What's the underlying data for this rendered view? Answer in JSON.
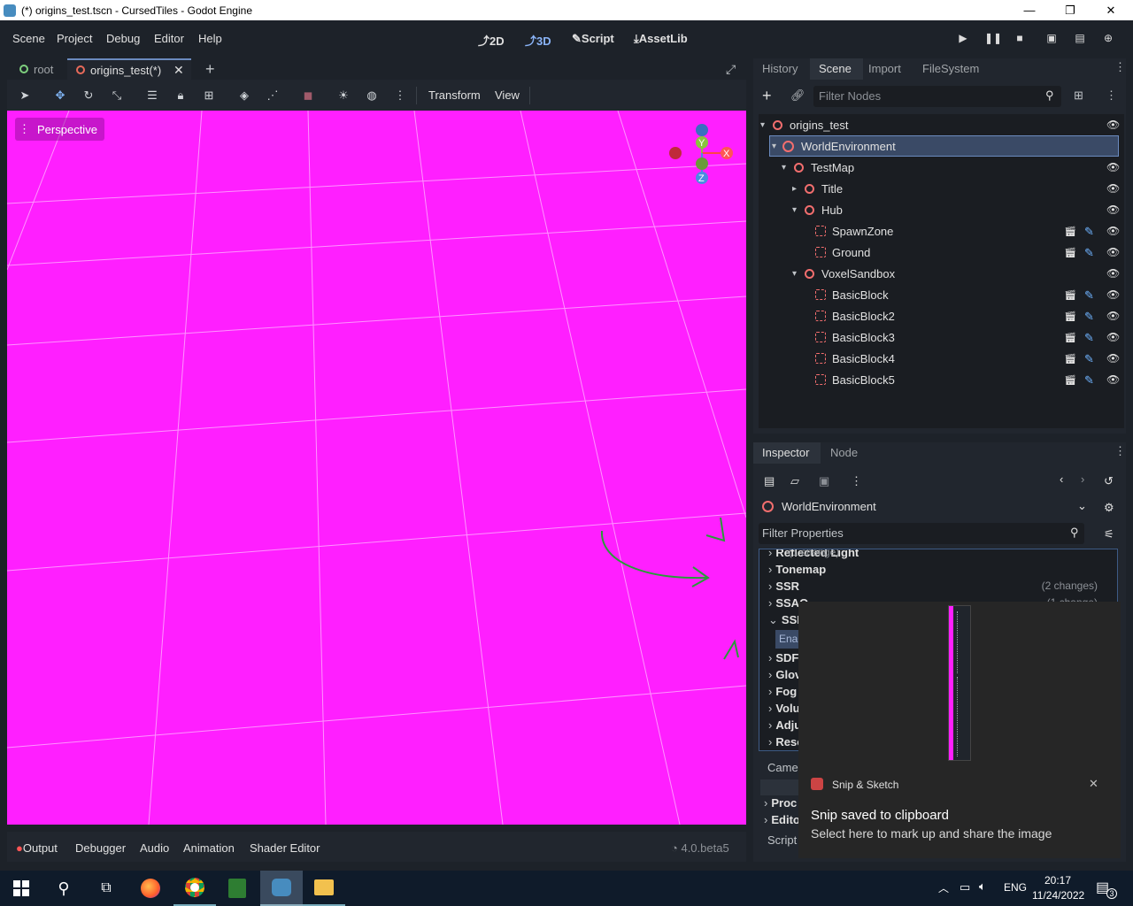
{
  "window": {
    "title": "(*) origins_test.tscn - CursedTiles - Godot Engine",
    "min": "—",
    "max": "❐",
    "close": "✕"
  },
  "menu": [
    "Scene",
    "Project",
    "Debug",
    "Editor",
    "Help"
  ],
  "workspaces": {
    "w2d": "2D",
    "w3d": "3D",
    "script": "Script",
    "assetlib": "AssetLib"
  },
  "tabs": {
    "root": "root",
    "scene": "origins_test(*)"
  },
  "toolbar": {
    "transform": "Transform",
    "view": "View"
  },
  "viewport": {
    "perspective": "Perspective",
    "bg_color": "#ff1fff",
    "gizmo": {
      "x": "X",
      "y": "Y",
      "z": "Z"
    }
  },
  "bottom": {
    "output": "Output",
    "debugger": "Debugger",
    "audio": "Audio",
    "animation": "Animation",
    "shader": "Shader Editor",
    "version": "4.0.beta5"
  },
  "dock_top": {
    "tabs": [
      "History",
      "Scene",
      "Import",
      "FileSystem"
    ],
    "filter_placeholder": "Filter Nodes",
    "nodes": [
      {
        "label": "origins_test"
      },
      {
        "label": "WorldEnvironment"
      },
      {
        "label": "TestMap"
      },
      {
        "label": "Title"
      },
      {
        "label": "Hub"
      },
      {
        "label": "SpawnZone"
      },
      {
        "label": "Ground"
      },
      {
        "label": "VoxelSandbox"
      },
      {
        "label": "BasicBlock"
      },
      {
        "label": "BasicBlock2"
      },
      {
        "label": "BasicBlock3"
      },
      {
        "label": "BasicBlock4"
      },
      {
        "label": "BasicBlock5"
      }
    ]
  },
  "inspector": {
    "tabs": [
      "Inspector",
      "Node"
    ],
    "object": "WorldEnvironment",
    "filter_placeholder": "Filter Properties",
    "sections": [
      {
        "label": "Reflected Light",
        "changes": "(1 change)"
      },
      {
        "label": "Tonemap",
        "changes": ""
      },
      {
        "label": "SSR",
        "changes": "(2 changes)"
      },
      {
        "label": "SSAO",
        "changes": "(1 change)"
      },
      {
        "label": "SSIL",
        "changes": ""
      },
      {
        "label": "Ena",
        "changes": ""
      },
      {
        "label": "SDF",
        "changes": ""
      },
      {
        "label": "Glov",
        "changes": ""
      },
      {
        "label": "Fog",
        "changes": ""
      },
      {
        "label": "Volu",
        "changes": ""
      },
      {
        "label": "Adju",
        "changes": ""
      },
      {
        "label": "Reso",
        "changes": ""
      }
    ],
    "camera": "Came",
    "proc": "Proc",
    "edito": "Edito",
    "script": "Script"
  },
  "toast": {
    "app": "Snip & Sketch",
    "title": "Snip saved to clipboard",
    "body": "Select here to mark up and share the image",
    "close": "✕"
  },
  "taskbar": {
    "lang": "ENG",
    "time": "20:17",
    "date": "11/24/2022",
    "notif": "3"
  }
}
